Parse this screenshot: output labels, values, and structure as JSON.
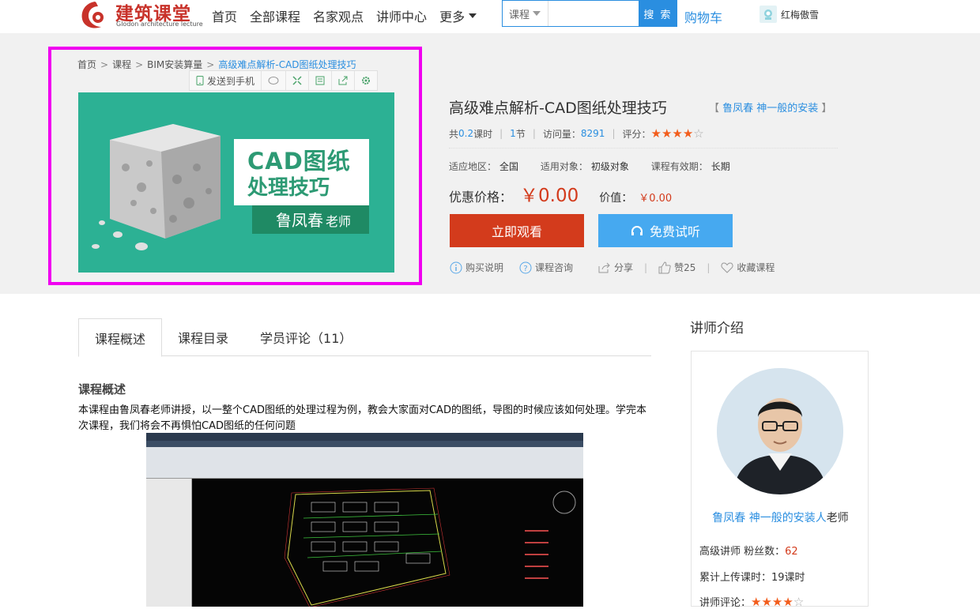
{
  "header": {
    "logo_cn": "建筑课堂",
    "logo_en": "Glodon architecture lecture",
    "nav": [
      "首页",
      "全部课程",
      "名家观点",
      "讲师中心"
    ],
    "nav_more": "更多",
    "search_category": "课程",
    "search_placeholder": "",
    "search_button": "搜 索",
    "cart": "购物车",
    "username": "红梅傲雪"
  },
  "breadcrumb": {
    "items": [
      "首页",
      "课程",
      "BIM安装算量"
    ],
    "current": "高级难点解析-CAD图纸处理技巧",
    "sep": ">"
  },
  "cover_toolbar": {
    "send_to_phone": "发送到手机"
  },
  "cover": {
    "title_line1": "CAD图纸",
    "title_line2": "处理技巧",
    "teacher": "鲁凤春",
    "teacher_suffix": "老师"
  },
  "course": {
    "title": "高级难点解析-CAD图纸处理技巧",
    "teacher_tag_open": "【",
    "teacher_tag": "鲁凤春 神一般的安装",
    "teacher_tag_close": "】",
    "hours_prefix": "共",
    "hours": "0.2",
    "hours_suffix": "课时",
    "sections": "1",
    "sections_suffix": "节",
    "visits_label": "访问量：",
    "visits": "8291",
    "rating_label": "评分：",
    "rating_stars": "★★★★",
    "rating_empty": "☆",
    "region_label": "适应地区：",
    "region": "全国",
    "audience_label": "适用对象：",
    "audience": "初级对象",
    "validity_label": "课程有效期：",
    "validity": "长期",
    "price_label": "优惠价格：",
    "price": "￥0.00",
    "value_label": "价值：",
    "value": "￥0.00",
    "watch_button": "立即观看",
    "trial_button": "免费试听",
    "actions": {
      "buy_info": "购买说明",
      "consult": "课程咨询",
      "share": "分享",
      "like": "赞25",
      "favorite": "收藏课程",
      "sep": "|"
    }
  },
  "tabs": [
    "课程概述",
    "课程目录",
    "学员评论（11）"
  ],
  "overview": {
    "heading": "课程概述",
    "text": " 本课程由鲁凤春老师讲授，以一整个CAD图纸的处理过程为例，教会大家面对CAD的图纸，导图的时候应该如何处理。学完本次课程，我们将会不再惧怕CAD图纸的任何问题"
  },
  "sidebar": {
    "title": "讲师介绍",
    "teacher_name": "鲁凤春 神一般的安装人",
    "teacher_suffix": "老师",
    "level_label": "高级讲师 粉丝数：",
    "fans": "62",
    "upload_label": "累计上传课时：",
    "upload_hours": "19课时",
    "review_label": "讲师评论：",
    "review_stars": "★★★★",
    "review_empty": "☆"
  },
  "colors": {
    "brand_red": "#c8322a",
    "link_blue": "#2a8ee0",
    "watch_red": "#d33b1c",
    "trial_blue": "#46a9f0",
    "cover_green": "#2cb194",
    "highlight": "#f000f0"
  }
}
